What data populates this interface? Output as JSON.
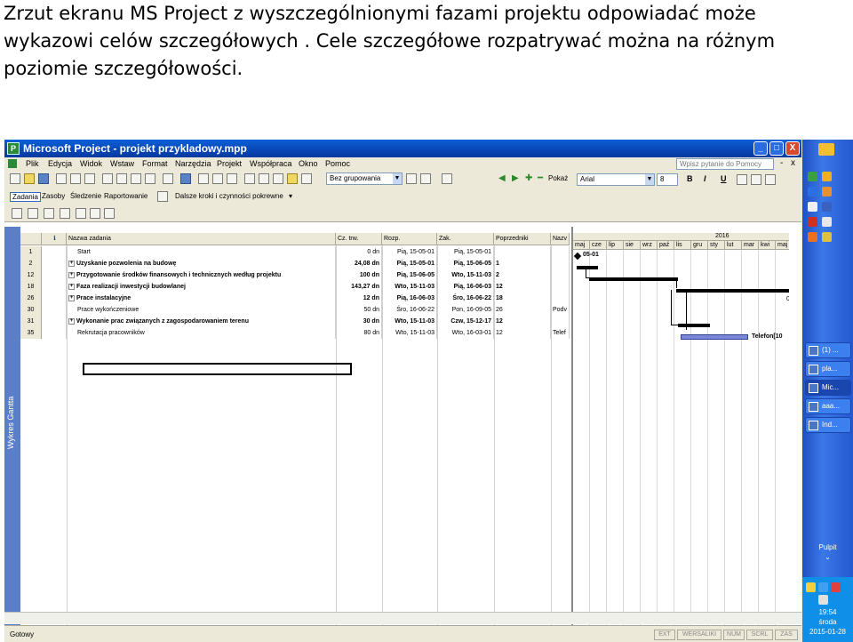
{
  "caption": "Zrzut ekranu MS Project z wyszczególnionymi fazami projektu odpowiadać może wykazowi celów szczegółowych . Cele szczegółowe rozpatrywać można na różnym poziomie szczegółowości.",
  "window": {
    "title": "Microsoft Project - projekt przykladowy.mpp",
    "minimize": "_",
    "maximize": "□",
    "close": "X"
  },
  "menu": {
    "items": [
      "Plik",
      "Edycja",
      "Widok",
      "Wstaw",
      "Format",
      "Narzędzia",
      "Projekt",
      "Współpraca",
      "Okno",
      "Pomoc"
    ],
    "help_placeholder": "Wpisz pytanie do Pomocy",
    "doc_controls": [
      "-",
      "x"
    ]
  },
  "toolbar1": {
    "group_combo": "Bez grupowania"
  },
  "toolbar2": {
    "show_label": "Pokaż",
    "font": "Arial",
    "size": "8",
    "bold": "B",
    "italic": "I",
    "underline": "U"
  },
  "toolbar3": {
    "tabs": [
      "Zadania",
      "Zasoby",
      "Śledzenie",
      "Raportowanie"
    ],
    "steps_combo": "Dalsze kroki i czynności pokrewne"
  },
  "view_label": "Wykres Gantta",
  "table": {
    "columns": [
      "",
      "ℹ",
      "Nazwa zadania",
      "Cz. trw.",
      "Rozp.",
      "Zak.",
      "Poprzedniki",
      "Nazv"
    ],
    "rows": [
      {
        "id": "1",
        "expander": "",
        "name": "Start",
        "bold": false,
        "indent": 1,
        "duration": "0 dn",
        "start": "Pią, 15-05-01",
        "finish": "Pią, 15-05-01",
        "pred": "",
        "res": ""
      },
      {
        "id": "2",
        "expander": "+",
        "name": "Uzyskanie pozwolenia na budowę",
        "bold": true,
        "indent": 0,
        "duration": "24,08 dn",
        "start": "Pią, 15-05-01",
        "finish": "Pią, 15-06-05",
        "pred": "1",
        "res": ""
      },
      {
        "id": "12",
        "expander": "+",
        "name": "Przygotowanie środków finansowych i technicznych według projektu",
        "bold": true,
        "indent": 0,
        "duration": "100 dn",
        "start": "Pią, 15-06-05",
        "finish": "Wto, 15-11-03",
        "pred": "2",
        "res": ""
      },
      {
        "id": "18",
        "expander": "+",
        "name": "Faza realizacji inwestycji budowlanej",
        "bold": true,
        "indent": 0,
        "duration": "143,27 dn",
        "start": "Wto, 15-11-03",
        "finish": "Pią, 16-06-03",
        "pred": "12",
        "res": ""
      },
      {
        "id": "26",
        "expander": "+",
        "name": "Prace instalacyjne",
        "bold": true,
        "indent": 0,
        "duration": "12 dn",
        "start": "Pią, 16-06-03",
        "finish": "Śro, 16-06-22",
        "pred": "18",
        "res": ""
      },
      {
        "id": "30",
        "expander": "",
        "name": "Prace wykończeniowe",
        "bold": false,
        "indent": 1,
        "duration": "50 dn",
        "start": "Śro, 16-06-22",
        "finish": "Pon, 16-09-05",
        "pred": "26",
        "res": "Podv"
      },
      {
        "id": "31",
        "expander": "+",
        "name": "Wykonanie prac związanych z zagospodarowaniem terenu",
        "bold": true,
        "indent": 0,
        "duration": "30 dn",
        "start": "Wto, 15-11-03",
        "finish": "Czw, 15-12-17",
        "pred": "12",
        "res": ""
      },
      {
        "id": "35",
        "expander": "",
        "name": "Rekrutacja pracowników",
        "bold": false,
        "indent": 1,
        "duration": "80 dn",
        "start": "Wto, 15-11-03",
        "finish": "Wto, 16-03-01",
        "pred": "12",
        "res": "Telef"
      }
    ]
  },
  "gantt": {
    "year": "2016",
    "months": [
      "maj",
      "cze",
      "lip",
      "sie",
      "wrz",
      "paź",
      "lis",
      "gru",
      "sty",
      "lut",
      "mar",
      "kwi",
      "maj"
    ],
    "milestone_label": "05-01",
    "bar_label": "Telefon[10",
    "end_label": "0"
  },
  "status": {
    "ready": "Gotowy",
    "indicators": [
      "EXT",
      "WERSALIKI",
      "NUM",
      "SCRL",
      "ZAS"
    ]
  },
  "taskbar": {
    "buttons": [
      "(1) ...",
      "pla...",
      "Mic...",
      "aaa...",
      "Ind..."
    ],
    "desktop": "Pulpit",
    "time": "19:54",
    "day": "środa",
    "date": "2015-01-28"
  },
  "colors": {
    "title_bar": "#0848b8",
    "taskbar": "#2558d0",
    "gantt_task": "#7a86d8",
    "chrome": "#ece9d8"
  }
}
